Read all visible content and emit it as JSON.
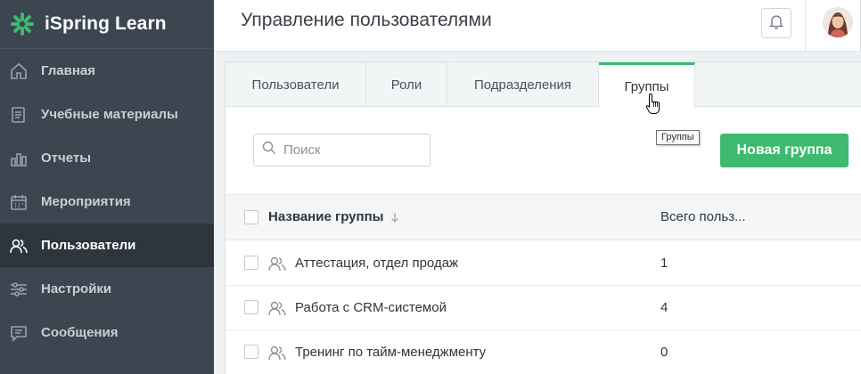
{
  "app": {
    "logo_text": "iSpring Learn"
  },
  "sidebar": {
    "items": [
      {
        "label": "Главная",
        "icon": "home-icon"
      },
      {
        "label": "Учебные материалы",
        "icon": "materials-icon"
      },
      {
        "label": "Отчеты",
        "icon": "reports-icon"
      },
      {
        "label": "Мероприятия",
        "icon": "calendar-icon"
      },
      {
        "label": "Пользователи",
        "icon": "users-icon",
        "active": true
      },
      {
        "label": "Настройки",
        "icon": "settings-icon"
      },
      {
        "label": "Сообщения",
        "icon": "messages-icon"
      }
    ]
  },
  "header": {
    "title": "Управление пользователями",
    "bell_icon": "bell-icon"
  },
  "tabs": [
    {
      "label": "Пользователи"
    },
    {
      "label": "Роли"
    },
    {
      "label": "Подразделения"
    },
    {
      "label": "Группы",
      "active": true
    }
  ],
  "tooltip": {
    "text": "Группы"
  },
  "search": {
    "placeholder": "Поиск"
  },
  "toolbar": {
    "new_group_label": "Новая группа"
  },
  "table": {
    "columns": [
      {
        "label": "Название группы",
        "sort": "descending"
      },
      {
        "label": "Всего польз..."
      }
    ],
    "rows": [
      {
        "name": "Аттестация, отдел продаж",
        "count": "1"
      },
      {
        "name": "Работа с CRM-системой",
        "count": "4"
      },
      {
        "name": "Тренинг по тайм-менеджменту",
        "count": "0"
      }
    ]
  },
  "colors": {
    "accent": "#3dba6f",
    "sidebar_bg": "#3c4650",
    "sidebar_active_bg": "#2d353d"
  }
}
